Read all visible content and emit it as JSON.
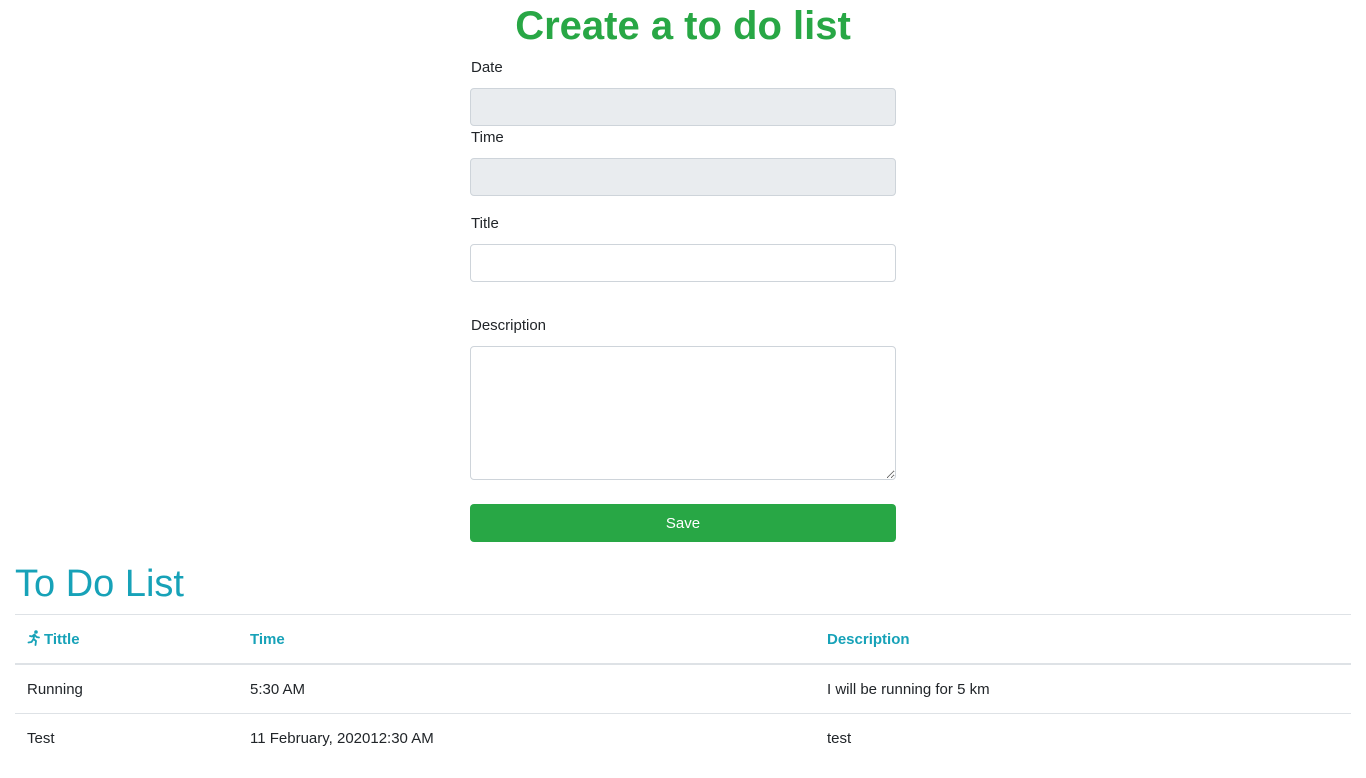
{
  "form": {
    "title": "Create a to do list",
    "date_label": "Date",
    "date_value": "",
    "time_label": "Time",
    "time_value": "",
    "title_label": "Title",
    "title_value": "",
    "description_label": "Description",
    "description_value": "",
    "save_label": "Save"
  },
  "list": {
    "title": "To Do List",
    "columns": [
      "Tittle",
      "Time",
      "Description"
    ],
    "title_column_icon": "running-person-icon",
    "rows": [
      {
        "title": "Running",
        "time": "5:30 AM",
        "description": "I will be running for 5 km"
      },
      {
        "title": "Test",
        "time": "11 February, 202012:30 AM",
        "description": "test"
      }
    ]
  },
  "colors": {
    "form_title": "#28a745",
    "save_button": "#28a745",
    "list_title": "#17a2b8",
    "table_header": "#17a2b8",
    "readonly_input": "#e9ecef"
  }
}
